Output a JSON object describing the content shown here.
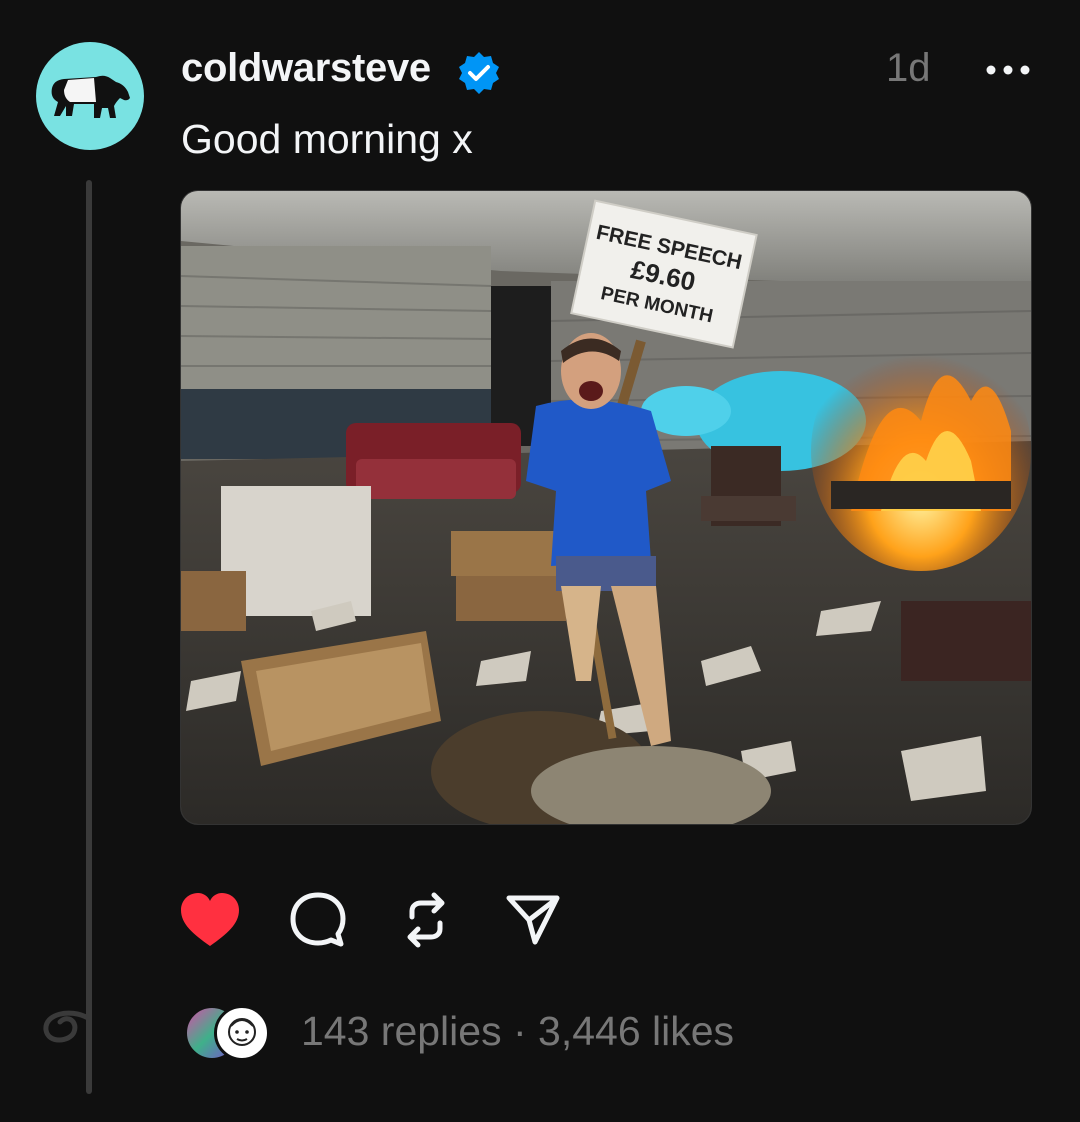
{
  "post": {
    "username": "coldwarsteve",
    "timestamp": "1d",
    "text": "Good morning x",
    "image": {
      "sign_line1": "FREE SPEECH",
      "sign_line2": "£9.60",
      "sign_line3": "PER MONTH"
    },
    "replies": "143 replies",
    "separator": " · ",
    "likes": "3,446 likes"
  },
  "icons": {
    "avatar": "tapir-icon",
    "verified": "verified-badge-icon",
    "more": "more-icon",
    "like": "heart-icon",
    "reply": "comment-icon",
    "repost": "repost-icon",
    "share": "send-icon",
    "thread_end": "loop-icon"
  },
  "colors": {
    "background": "#101010",
    "text": "#f3f5f7",
    "muted": "#777777",
    "verified": "#0095f6",
    "like": "#ff3040",
    "avatar_bg": "#79e2e2"
  }
}
